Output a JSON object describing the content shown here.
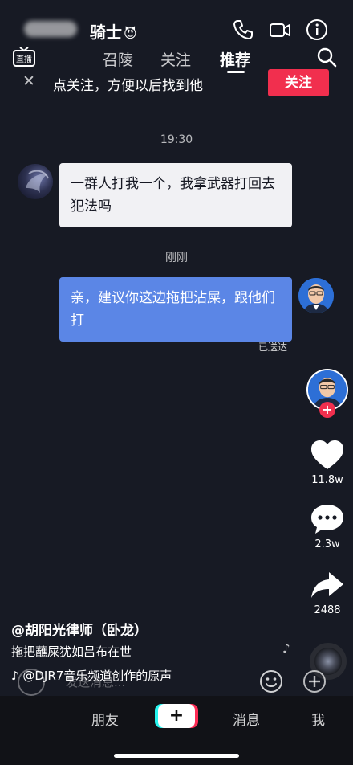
{
  "chat_header": {
    "title": "骑士",
    "title_emoji": "😈",
    "icons": [
      "phone-icon",
      "video-call-icon",
      "info-icon"
    ]
  },
  "top_nav": {
    "live_icon_label": "直播",
    "tabs": [
      {
        "label": "召陵"
      },
      {
        "label": "关注"
      },
      {
        "label": "推荐"
      }
    ],
    "active_tab": "推荐"
  },
  "follow_banner": {
    "close_symbol": "✕",
    "text": "点关注，方便以后找到他",
    "button_label": "关注",
    "button_color": "#f12f4e"
  },
  "messages": [
    {
      "type": "timestamp",
      "text": "19:30"
    },
    {
      "type": "incoming",
      "text": "一群人打我一个，我拿武器打回去犯法吗"
    },
    {
      "type": "timestamp",
      "text": "刚刚"
    },
    {
      "type": "outgoing",
      "text": "亲，建议你这边拖把沾屎，跟他们打",
      "status": "已送达"
    }
  ],
  "actions": {
    "likes": "11.8w",
    "comments": "2.3w",
    "shares": "2488"
  },
  "caption": {
    "author": "@胡阳光律师（卧龙）",
    "description": "拖把蘸屎犹如吕布在世",
    "music": "@DJR7音乐频道创作的原声"
  },
  "input": {
    "placeholder": "发送消息..."
  },
  "bottom_tabs": {
    "friends": "朋友",
    "create": "+",
    "messages": "消息",
    "me": "我"
  },
  "colors": {
    "background": "#171a24",
    "incoming_bubble": "#f1f1f4",
    "outgoing_bubble": "#5b86e6",
    "accent": "#f12f4e"
  }
}
